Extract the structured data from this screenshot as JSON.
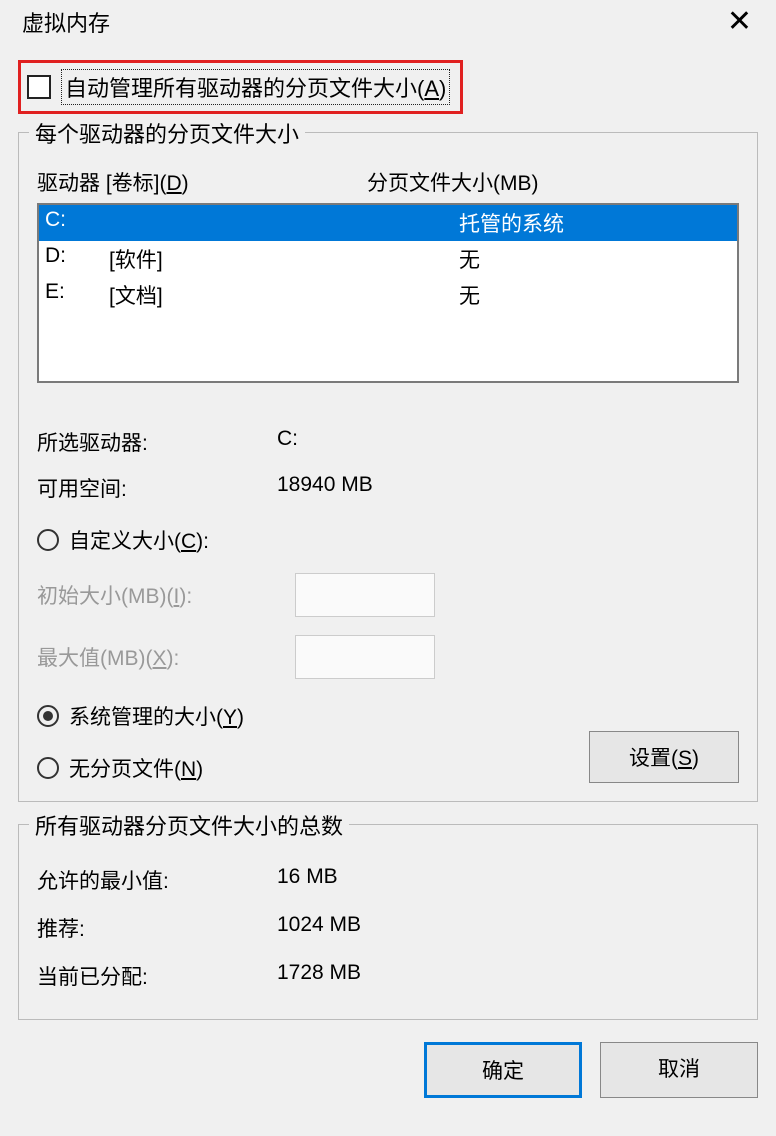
{
  "title": "虚拟内存",
  "close_glyph": "✕",
  "auto_manage_label": "自动管理所有驱动器的分页文件大小(A)",
  "group1": {
    "legend": "每个驱动器的分页文件大小",
    "drive_header_label": "驱动器  [卷标](D)",
    "size_header_label": "分页文件大小(MB)",
    "drives": [
      {
        "letter": "C:",
        "label": "",
        "size": "托管的系统",
        "selected": true
      },
      {
        "letter": "D:",
        "label": "[软件]",
        "size": "无",
        "selected": false
      },
      {
        "letter": "E:",
        "label": "[文档]",
        "size": "无",
        "selected": false
      }
    ],
    "selected_drive_label": "所选驱动器:",
    "selected_drive_value": "C:",
    "free_space_label": "可用空间:",
    "free_space_value": "18940 MB",
    "custom_size_label": "自定义大小(C):",
    "initial_size_label": "初始大小(MB)(I):",
    "max_size_label": "最大值(MB)(X):",
    "system_managed_label": "系统管理的大小(Y)",
    "no_paging_label": "无分页文件(N)",
    "set_button_label": "设置(S)"
  },
  "group2": {
    "legend": "所有驱动器分页文件大小的总数",
    "min_allowed_label": "允许的最小值:",
    "min_allowed_value": "16 MB",
    "recommended_label": "推荐:",
    "recommended_value": "1024 MB",
    "allocated_label": "当前已分配:",
    "allocated_value": "1728 MB"
  },
  "ok_label": "确定",
  "cancel_label": "取消"
}
